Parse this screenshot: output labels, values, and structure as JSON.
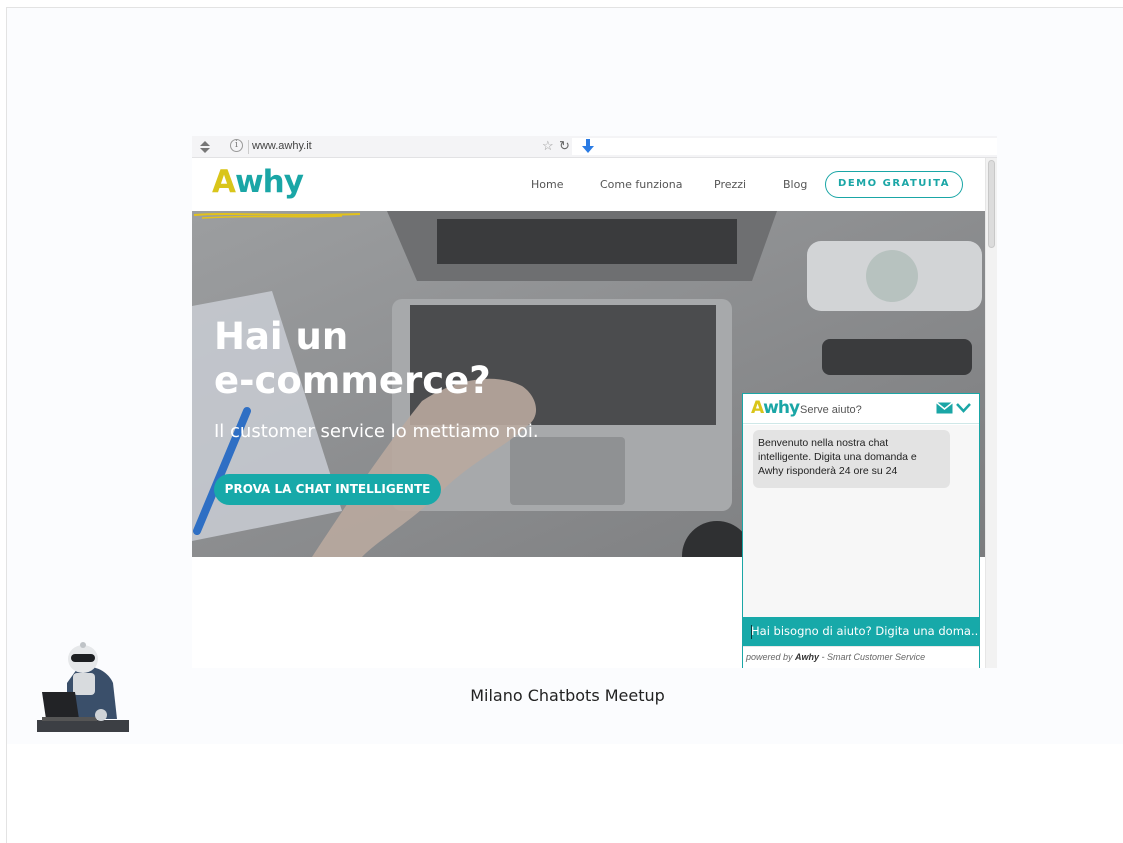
{
  "browser": {
    "url": "www.awhy.it",
    "icons": [
      "nav-arrows-icon",
      "info-icon",
      "star-icon",
      "reload-icon",
      "download-arrow-icon"
    ]
  },
  "site": {
    "logo": {
      "letter": "A",
      "rest": "why"
    },
    "nav": [
      "Home",
      "Come funziona",
      "Prezzi",
      "Blog"
    ],
    "demo_button": "DEMO GRATUITA"
  },
  "hero": {
    "title": "Hai un\ne-commerce?",
    "subtitle": "Il customer service lo mettiamo noi.",
    "cta": "PROVA LA CHAT INTELLIGENTE"
  },
  "chat": {
    "logo": {
      "letter": "A",
      "rest": "why"
    },
    "title": "Serve aiuto?",
    "message": "Benvenuto nella nostra chat\nintelligente. Digita una domanda e\nAwhy risponderà 24 ore su 24",
    "input_placeholder": "Hai bisogno di aiuto? Digita una doma...",
    "footer_prefix": "powered by ",
    "footer_brand": "Awhy",
    "footer_suffix": " - Smart Customer Service"
  },
  "slide": {
    "caption": "Milano Chatbots Meetup"
  },
  "colors": {
    "teal": "#1aa6a6",
    "yellow": "#d9c51a"
  }
}
